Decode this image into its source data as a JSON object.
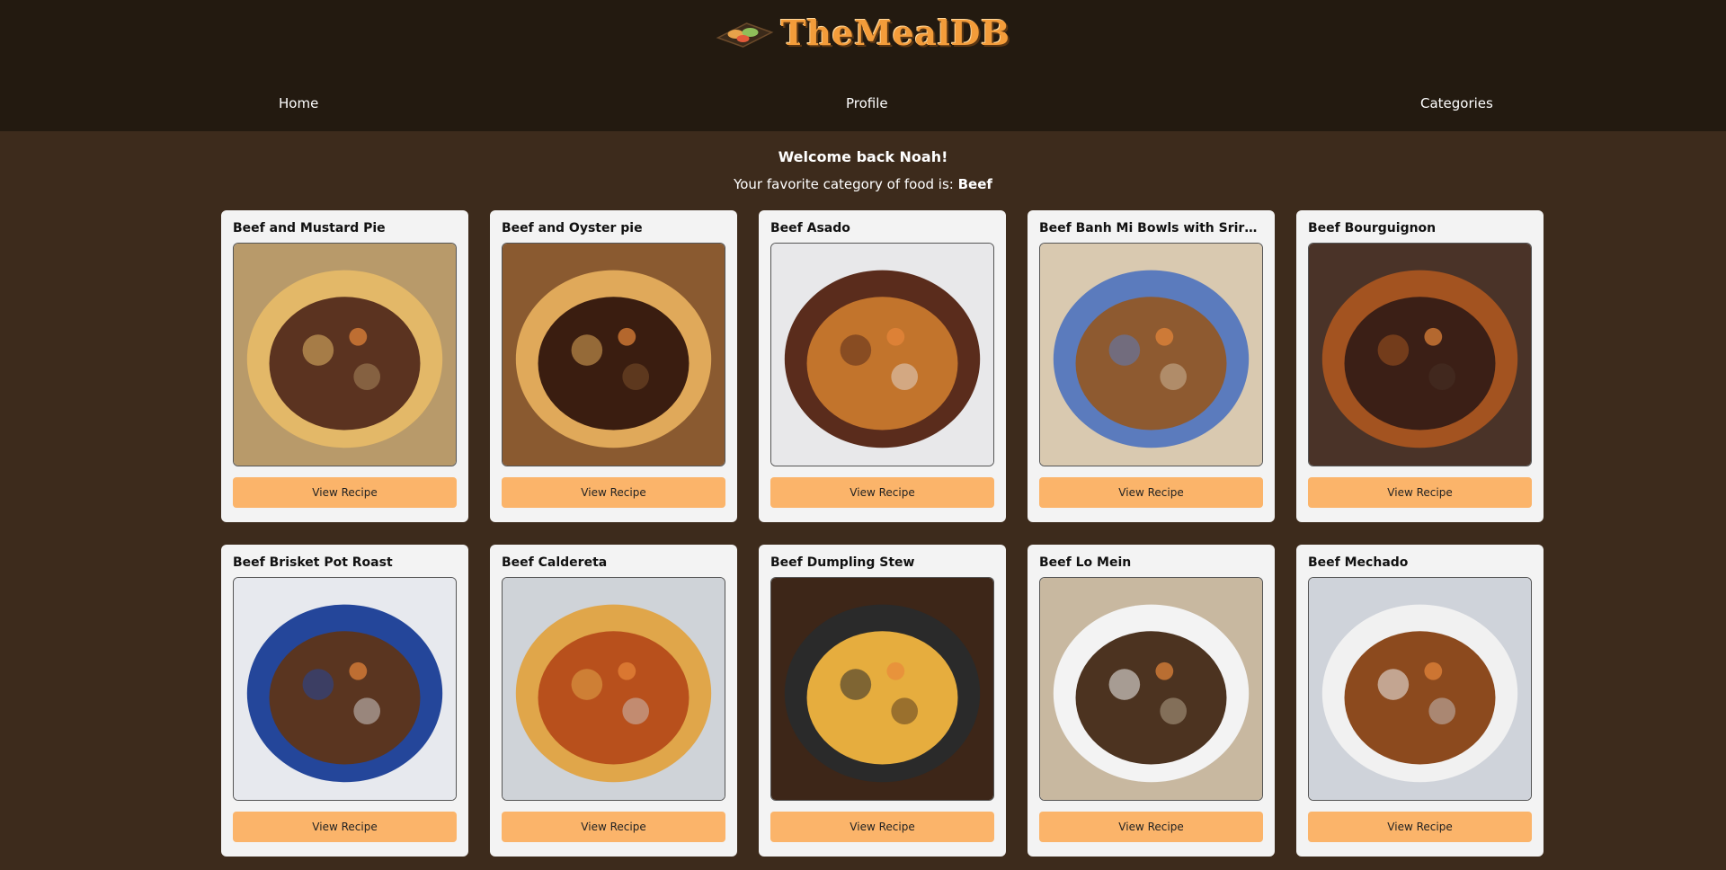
{
  "brand": {
    "name": "TheMealDB"
  },
  "nav": {
    "home": "Home",
    "profile": "Profile",
    "categories": "Categories"
  },
  "welcome": "Welcome back Noah!",
  "favorite": {
    "prefix": "Your favorite category of food is:",
    "category": "Beef"
  },
  "meals": [
    {
      "title": "Beef and Mustard Pie",
      "button": "View Recipe",
      "colors": [
        "#b89a6a",
        "#e3b868",
        "#5b3320"
      ]
    },
    {
      "title": "Beef and Oyster pie",
      "button": "View Recipe",
      "colors": [
        "#8a5a30",
        "#e0a95a",
        "#3a1d10"
      ]
    },
    {
      "title": "Beef Asado",
      "button": "View Recipe",
      "colors": [
        "#e8e8ea",
        "#5a2c1c",
        "#c2742c"
      ]
    },
    {
      "title": "Beef Banh Mi Bowls with Sriracha Mayo",
      "button": "View Recipe",
      "colors": [
        "#d9c9b0",
        "#5b7bbd",
        "#8e5a30"
      ]
    },
    {
      "title": "Beef Bourguignon",
      "button": "View Recipe",
      "colors": [
        "#4a3328",
        "#a35320",
        "#3b1f16"
      ]
    },
    {
      "title": "Beef Brisket Pot Roast",
      "button": "View Recipe",
      "colors": [
        "#e7e9ee",
        "#24469a",
        "#5a3520"
      ]
    },
    {
      "title": "Beef Caldereta",
      "button": "View Recipe",
      "colors": [
        "#cfd3d8",
        "#e0a64a",
        "#b8501c"
      ]
    },
    {
      "title": "Beef Dumpling Stew",
      "button": "View Recipe",
      "colors": [
        "#3d2618",
        "#2a2a2a",
        "#e6ad3e"
      ]
    },
    {
      "title": "Beef Lo Mein",
      "button": "View Recipe",
      "colors": [
        "#c8b8a0",
        "#f3f3f3",
        "#4c3320"
      ]
    },
    {
      "title": "Beef Mechado",
      "button": "View Recipe",
      "colors": [
        "#cfd3da",
        "#f1f1f1",
        "#8c4a1e"
      ]
    }
  ]
}
